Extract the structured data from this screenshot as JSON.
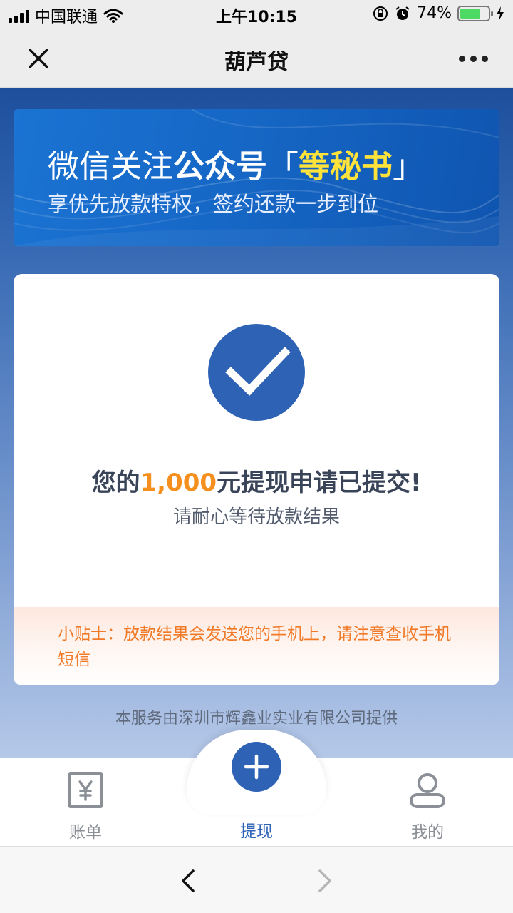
{
  "status_bar": {
    "carrier": "中国联通",
    "time": "上午10:15",
    "battery_percent": "74%",
    "battery_level": 0.74
  },
  "nav": {
    "title": "葫芦贷",
    "close_icon": "close-icon",
    "more_icon": "more-dots-icon"
  },
  "banner": {
    "line1_prefix": "微信关注",
    "line1_bold": "公众号",
    "bracket_open": "「",
    "account_name": "等秘书",
    "bracket_close": "」",
    "line2": "享优先放款特权，签约还款一步到位"
  },
  "result": {
    "title_prefix": "您的",
    "amount": "1,000",
    "title_suffix": "元提现申请已提交!",
    "subtitle": "请耐心等待放款结果",
    "tip": "小贴士：放款结果会发送您的手机上，请注意查收手机短信"
  },
  "footer_credit": "本服务由深圳市辉鑫业实业有限公司提供",
  "tabs": [
    {
      "label": "账单",
      "icon": "bill-yen-icon"
    },
    {
      "label": "提现",
      "icon": "plus-circle-icon"
    },
    {
      "label": "我的",
      "icon": "user-icon"
    }
  ],
  "colors": {
    "accent_blue": "#2e62b5",
    "amount_orange": "#f5901e",
    "tip_orange": "#f07a28",
    "banner_yellow": "#ffe33b"
  }
}
